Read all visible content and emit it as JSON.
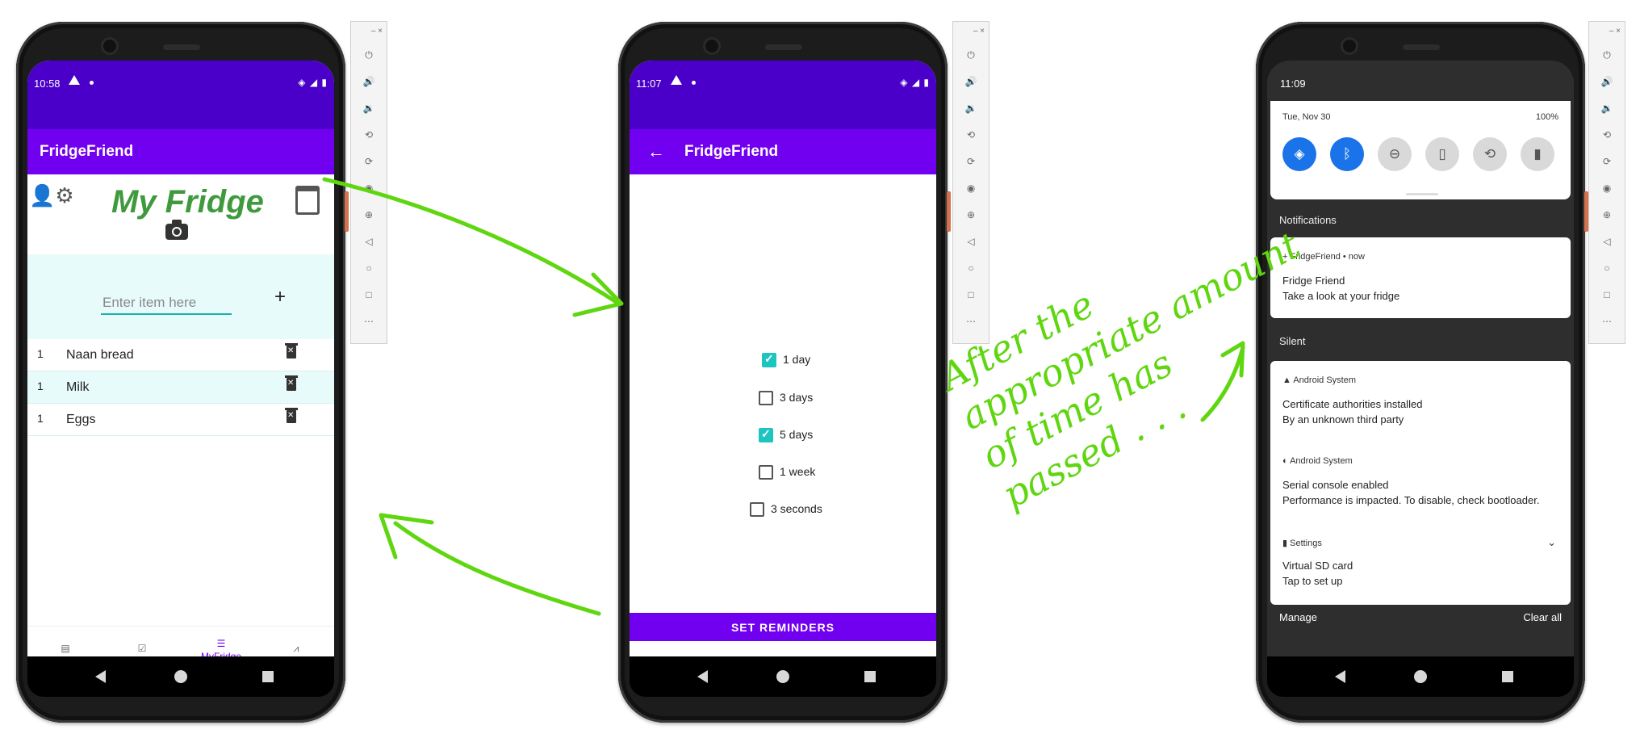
{
  "phone1": {
    "status": {
      "time": "10:58"
    },
    "app_title": "FridgeFriend",
    "page_title": "My Fridge",
    "input_placeholder": "Enter item here",
    "add_label": "+",
    "items": [
      {
        "qty": "1",
        "name": "Naan bread"
      },
      {
        "qty": "1",
        "name": "Milk"
      },
      {
        "qty": "1",
        "name": "Eggs"
      }
    ],
    "nav": {
      "active_label": "MyFridge",
      "icons": [
        "book-icon",
        "checklist-icon",
        "list-icon",
        "chart-icon"
      ]
    }
  },
  "phone2": {
    "status": {
      "time": "11:07"
    },
    "app_title": "FridgeFriend",
    "options": [
      {
        "label": "1 day",
        "checked": true
      },
      {
        "label": "3 days",
        "checked": false
      },
      {
        "label": "5 days",
        "checked": true
      },
      {
        "label": "1 week",
        "checked": false
      },
      {
        "label": "3 seconds",
        "checked": false
      }
    ],
    "button": "SET REMINDERS"
  },
  "phone3": {
    "status": {
      "time": "11:09"
    },
    "quick_settings": {
      "date": "Tue, Nov 30",
      "battery": "100%"
    },
    "notifications_header": "Notifications",
    "notif1": {
      "app": "FridgeFriend • now",
      "title": "Fridge Friend",
      "body": "Take a look at your fridge"
    },
    "silent_header": "Silent",
    "silent": [
      {
        "app": "Android System",
        "title": "Certificate authorities installed",
        "body": "By an unknown third party"
      },
      {
        "app": "Android System",
        "title": "Serial console enabled",
        "body": "Performance is impacted. To disable, check bootloader."
      },
      {
        "app": "Settings",
        "title": "Virtual SD card",
        "body": "Tap to set up"
      }
    ],
    "manage": "Manage",
    "clear_all": "Clear all"
  },
  "annotation": {
    "handwritten": "After the appropriate amount of time has passed ...",
    "color": "#5fd60f"
  }
}
